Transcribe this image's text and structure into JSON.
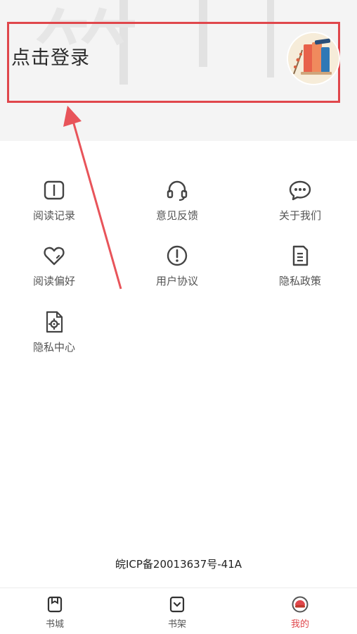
{
  "header": {
    "login_text": "点击登录"
  },
  "menu": [
    {
      "label": "阅读记录",
      "icon": "book-open-icon"
    },
    {
      "label": "意见反馈",
      "icon": "headset-icon"
    },
    {
      "label": "关于我们",
      "icon": "chat-bubble-icon"
    },
    {
      "label": "阅读偏好",
      "icon": "heart-icon"
    },
    {
      "label": "用户协议",
      "icon": "alert-circle-icon"
    },
    {
      "label": "隐私政策",
      "icon": "document-icon"
    },
    {
      "label": "隐私中心",
      "icon": "gear-document-icon"
    }
  ],
  "footer": {
    "icp": "皖ICP备20013637号-41A"
  },
  "tabs": [
    {
      "label": "书城",
      "icon": "bookstore-icon",
      "active": false
    },
    {
      "label": "书架",
      "icon": "bookshelf-icon",
      "active": false
    },
    {
      "label": "我的",
      "icon": "profile-icon",
      "active": true
    }
  ],
  "colors": {
    "accent": "#e0474c",
    "highlight_box": "#e0474c"
  }
}
